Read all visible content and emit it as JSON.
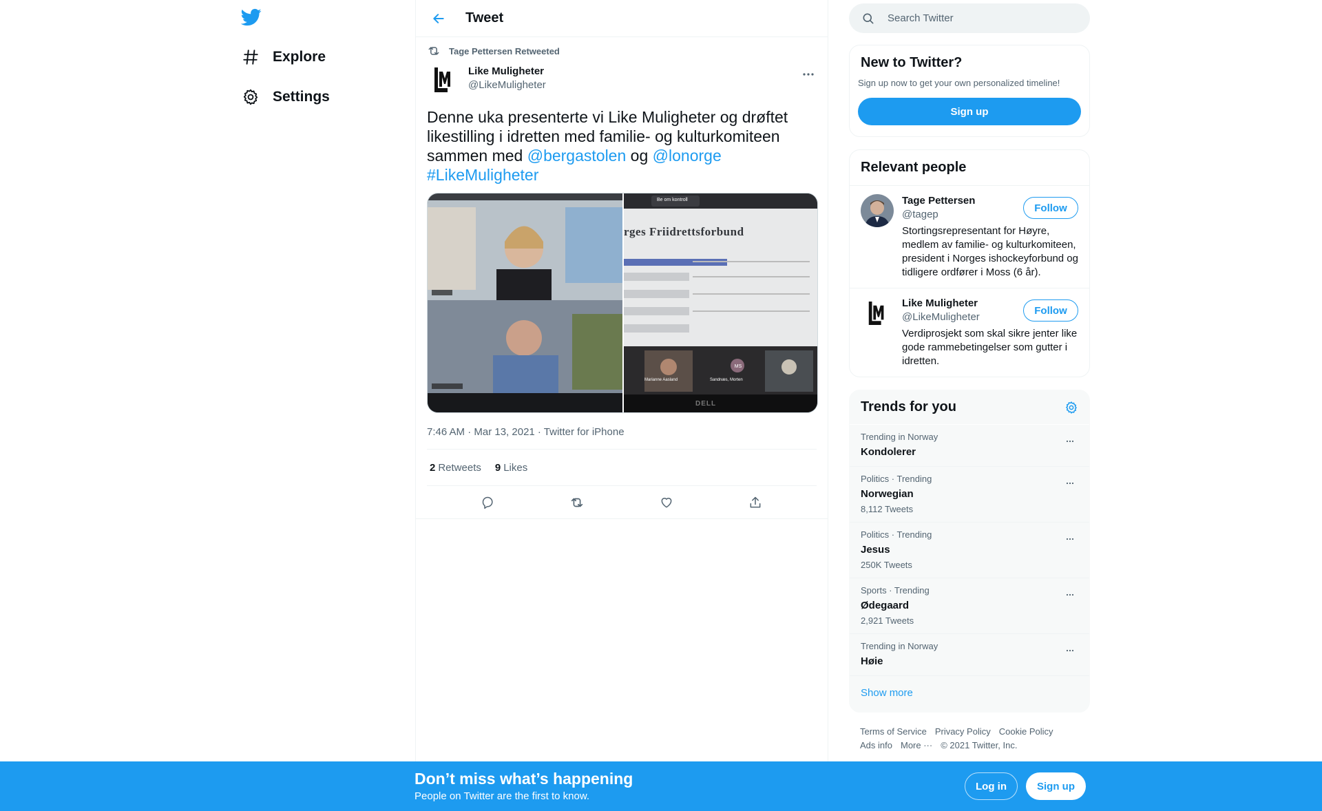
{
  "colors": {
    "accent": "#1d9bf0",
    "text": "#0f1419",
    "secondary": "#536471"
  },
  "nav": {
    "logo_icon": "twitter-bird-icon",
    "items": [
      {
        "label": "Explore",
        "icon": "hashtag-icon"
      },
      {
        "label": "Settings",
        "icon": "gear-icon"
      }
    ]
  },
  "header": {
    "title": "Tweet",
    "back_icon": "arrow-left-icon"
  },
  "tweet": {
    "retweeted_by": "Tage Pettersen Retweeted",
    "author_name": "Like Muligheter",
    "author_handle": "@LikeMuligheter",
    "text_part1": "Denne uka presenterte vi Like Muligheter og drøftet likestilling i idretten med familie- og kulturkomiteen sammen med ",
    "mention1": "@bergastolen",
    "text_part2": " og ",
    "mention2": "@lonorge",
    "hashtag": "#LikeMuligheter",
    "media_left_label": "Video call screenshot",
    "media_right_heading": "rges Friidrettsforbund",
    "media_right_button": "Be om kontroll",
    "media_right_names": [
      "Marianne Aasland",
      "Sandnæs, Morten"
    ],
    "media_right_initials": "MS",
    "media_brand": "DELL",
    "meta": "7:46 AM · Mar 13, 2021 · Twitter for iPhone",
    "retweets_count": "2",
    "retweets_label": "Retweets",
    "likes_count": "9",
    "likes_label": "Likes"
  },
  "search": {
    "placeholder": "Search Twitter"
  },
  "new_to_twitter": {
    "title": "New to Twitter?",
    "subtitle": "Sign up now to get your own personalized timeline!",
    "signup_label": "Sign up"
  },
  "relevant_people": {
    "title": "Relevant people",
    "people": [
      {
        "name": "Tage Pettersen",
        "handle": "@tagep",
        "bio": "Stortingsrepresentant for Høyre, medlem av familie- og kulturkomiteen, president i Norges ishockeyforbund og tidligere ordfører i Moss (6 år).",
        "follow_label": "Follow"
      },
      {
        "name": "Like Muligheter",
        "handle": "@LikeMuligheter",
        "bio": "Verdiprosjekt som skal sikre jenter like gode rammebetingelser som gutter i idretten.",
        "follow_label": "Follow"
      }
    ]
  },
  "trends": {
    "title": "Trends for you",
    "items": [
      {
        "context": "Trending in Norway",
        "name": "Kondolerer",
        "count": ""
      },
      {
        "context": "Politics · Trending",
        "name": "Norwegian",
        "count": "8,112 Tweets"
      },
      {
        "context": "Politics · Trending",
        "name": "Jesus",
        "count": "250K Tweets"
      },
      {
        "context": "Sports · Trending",
        "name": "Ødegaard",
        "count": "2,921 Tweets"
      },
      {
        "context": "Trending in Norway",
        "name": "Høie",
        "count": ""
      }
    ],
    "show_more": "Show more"
  },
  "footer": {
    "terms": "Terms of Service",
    "privacy": "Privacy Policy",
    "cookie": "Cookie Policy",
    "ads": "Ads info",
    "more": "More ···",
    "copyright": "© 2021 Twitter, Inc."
  },
  "bottom_bar": {
    "title": "Don’t miss what’s happening",
    "subtitle": "People on Twitter are the first to know.",
    "login_label": "Log in",
    "signup_label": "Sign up"
  }
}
